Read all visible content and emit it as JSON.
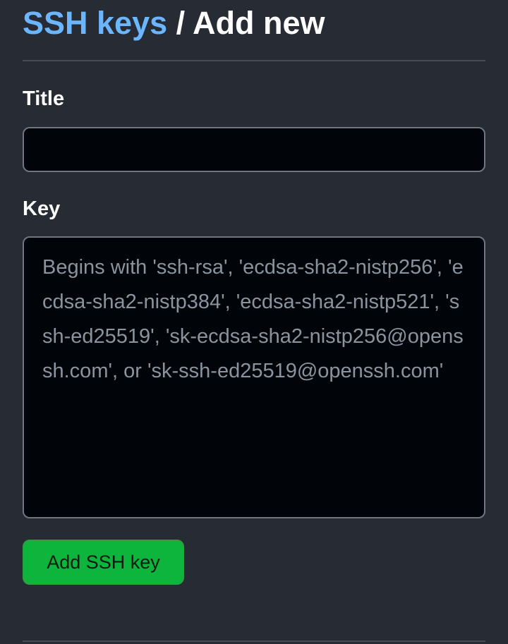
{
  "breadcrumb": {
    "parent": "SSH keys",
    "separator": "/",
    "current": "Add new"
  },
  "form": {
    "title_label": "Title",
    "title_value": "",
    "key_label": "Key",
    "key_value": "",
    "key_placeholder": "Begins with 'ssh-rsa', 'ecdsa-sha2-nistp256', 'ecdsa-sha2-nistp384', 'ecdsa-sha2-nistp521', 'ssh-ed25519', 'sk-ecdsa-sha2-nistp256@openssh.com', or 'sk-ssh-ed25519@openssh.com'",
    "submit_label": "Add SSH key"
  },
  "colors": {
    "background": "#272b33",
    "link": "#6cb6ff",
    "input_background": "#010409",
    "button_green": "#0db53c"
  }
}
